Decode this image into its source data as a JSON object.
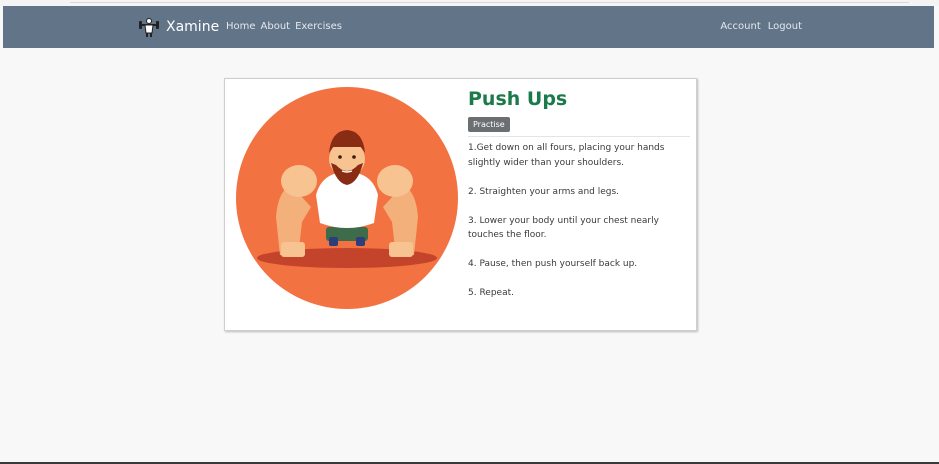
{
  "navbar": {
    "brand": "Xamine",
    "left_links": [
      "Home",
      "About",
      "Exercises"
    ],
    "right_links": [
      "Account",
      "Logout"
    ],
    "brand_icon": "weightlifter-icon"
  },
  "exercise": {
    "title": "Push Ups",
    "practise_label": "Practise",
    "steps": [
      "1.Get down on all fours, placing your hands slightly wider than your shoulders.",
      "2. Straighten your arms and legs.",
      "3. Lower your body until your chest nearly touches the floor.",
      "4. Pause, then push yourself back up.",
      "5. Repeat."
    ]
  },
  "colors": {
    "navbar": "#627488",
    "title": "#1b7a4a",
    "illustration_circle": "#f37242"
  }
}
